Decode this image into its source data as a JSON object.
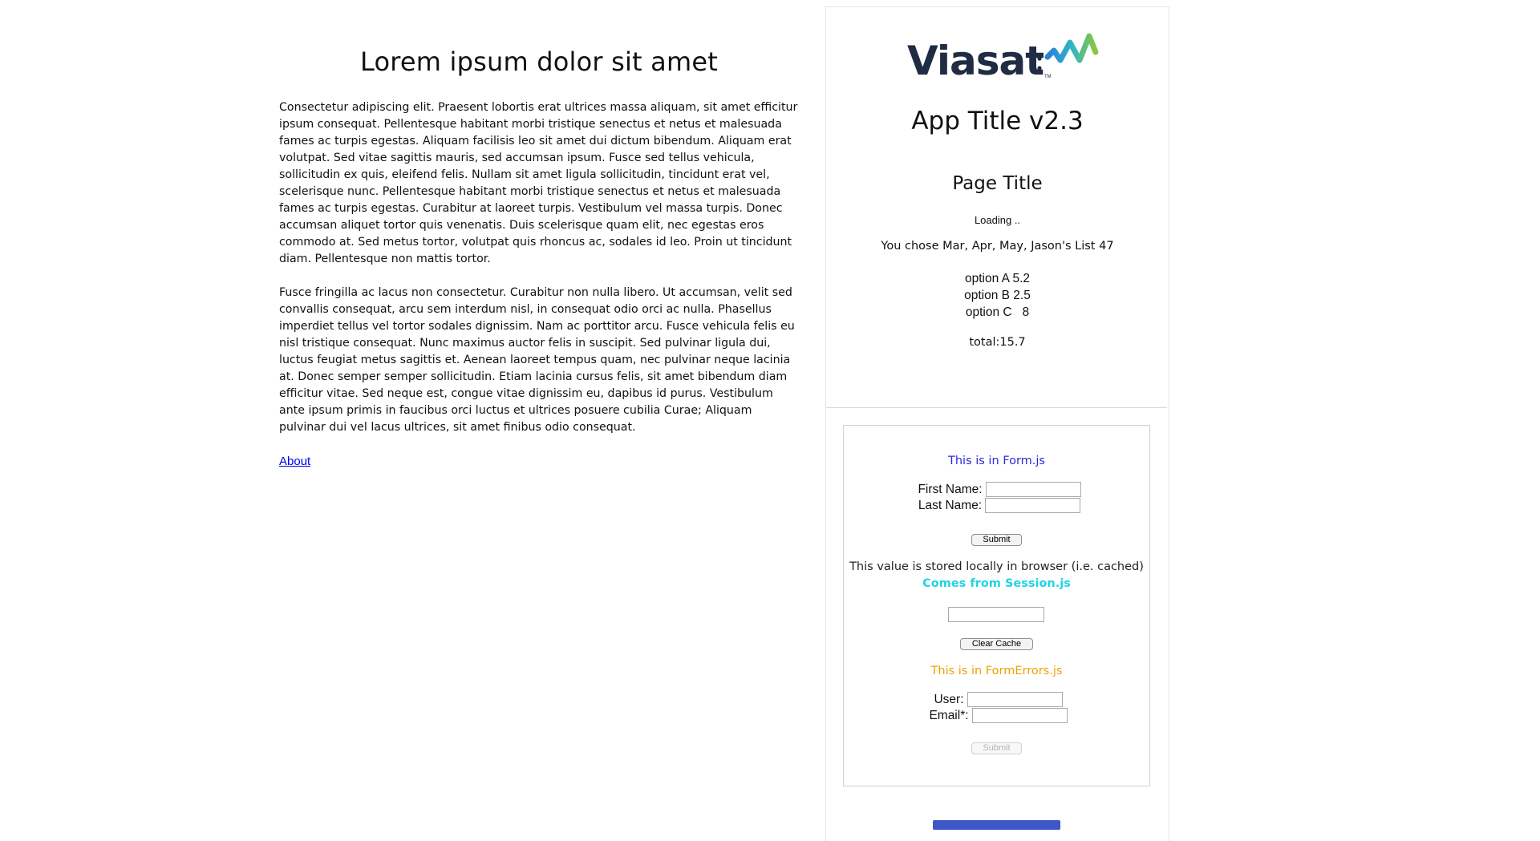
{
  "article": {
    "heading": "Lorem ipsum dolor sit amet",
    "paragraphs": [
      "Consectetur adipiscing elit. Praesent lobortis erat ultrices massa aliquam, sit amet efficitur ipsum consequat. Pellentesque habitant morbi tristique senectus et netus et malesuada fames ac turpis egestas. Aliquam facilisis leo sit amet dui dictum bibendum. Aliquam erat volutpat. Sed vitae sagittis mauris, sed accumsan ipsum. Fusce sed tellus vehicula, sollicitudin ex quis, eleifend felis. Nullam sit amet ligula sollicitudin, tincidunt erat vel, scelerisque nunc. Pellentesque habitant morbi tristique senectus et netus et malesuada fames ac turpis egestas. Curabitur at laoreet turpis. Vestibulum vel massa turpis. Donec accumsan aliquet tortor quis venenatis. Duis scelerisque quam elit, nec egestas eros commodo at. Sed metus tortor, volutpat quis rhoncus ac, sodales id leo. Proin ut tincidunt diam. Pellentesque non mattis tortor.",
      "Fusce fringilla ac lacus non consectetur. Curabitur non nulla libero. Ut accumsan, velit sed convallis consequat, arcu sem interdum nisl, in consequat odio orci ac nulla. Phasellus imperdiet tellus vel tortor sodales dignissim. Nam ac porttitor arcu. Fusce vehicula felis eu nisl tristique consequat. Nunc maximus auctor felis in suscipit. Sed pulvinar ligula dui, luctus feugiat metus sagittis et. Aenean laoreet tempus quam, nec pulvinar neque lacinia at. Donec semper semper sollicitudin. Etiam lacinia cursus felis, sit amet bibendum diam efficitur vitae. Sed neque est, congue vitae dignissim eu, dapibus id purus. Vestibulum ante ipsum primis in faucibus orci luctus et ultrices posuere cubilia Curae; Aliquam pulvinar dui vel lacus ultrices, sit amet finibus odio consequat."
    ],
    "about_link": "About"
  },
  "panel": {
    "logo_text": "Viasat",
    "logo_tm": "TM",
    "logo_colors": [
      "#202c44",
      "#2a9fd6",
      "#7bc043"
    ],
    "app_title": "App Title v2.3",
    "page_title": "Page Title",
    "loading": "Loading ..",
    "chose": "You chose Mar, Apr, May, Jason's List 47",
    "options": [
      "option A 5.2",
      "option B 2.5",
      "option C   8"
    ],
    "total": "total:15.7"
  },
  "form": {
    "form_js_title": "This is in Form.js",
    "first_name_label": "First Name:",
    "first_name_value": "",
    "last_name_label": "Last Name:",
    "last_name_value": "",
    "submit_label": "Submit",
    "stored_text": "This value is stored locally in browser (i.e. cached)",
    "session_text": "Comes from Session.js",
    "cache_value": "",
    "clear_cache_label": "Clear Cache",
    "errors_title": "This is in FormErrors.js",
    "user_label": "User:",
    "user_value": "",
    "email_label": "Email*:",
    "email_value": "",
    "submit2_label": "Submit"
  },
  "colors": {
    "form_js": "#2b2bd8",
    "session": "#22d3e6",
    "errors": "#f0a000",
    "link": "#0000ee",
    "bottom_button": "#3f57c6"
  }
}
